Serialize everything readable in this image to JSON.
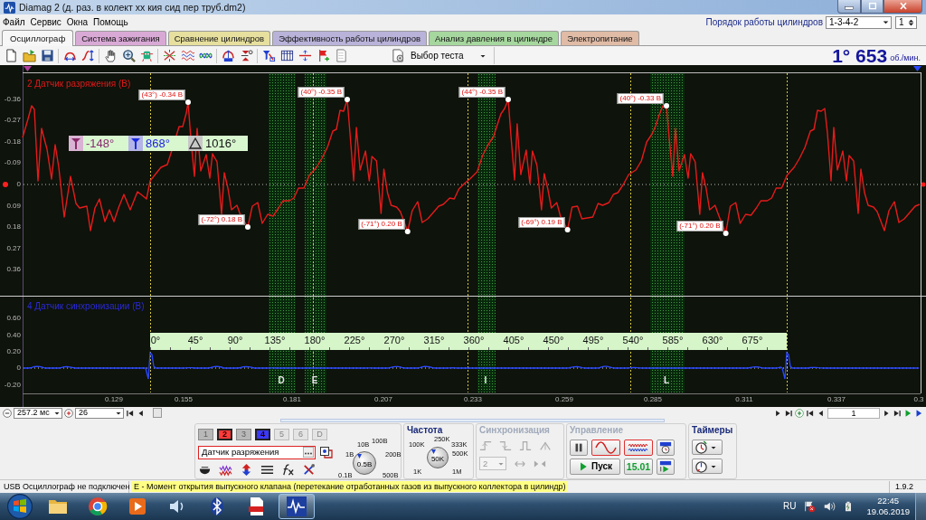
{
  "window": {
    "title": "Diamag 2 (д. раз. в колект хх кия сид пер труб.dm2)"
  },
  "menu": [
    "Файл",
    "Сервис",
    "Окна",
    "Помощь"
  ],
  "firing_order": {
    "label": "Порядок работы цилиндров",
    "value": "1-3-4-2",
    "cylinder": "1"
  },
  "tabs": [
    {
      "label": "Осциллограф",
      "selected": true,
      "color": "#f7f7f7"
    },
    {
      "label": "Система зажигания",
      "selected": false,
      "color": "#d9a9d6"
    },
    {
      "label": "Сравнение цилиндров",
      "selected": false,
      "color": "#e6df9e"
    },
    {
      "label": "Эффективность работы цилиндров",
      "selected": false,
      "color": "#b9b3d9"
    },
    {
      "label": "Анализ давления в цилиндре",
      "selected": false,
      "color": "#a6d79e"
    },
    {
      "label": "Электропитание",
      "selected": false,
      "color": "#e0bba6"
    }
  ],
  "toolbar": {
    "test_select": "Выбор теста",
    "rpm": "1° 653",
    "rpm_unit": "об./мин."
  },
  "oscillogram": {
    "upper": {
      "title": "2 Датчик разряжения (В)",
      "yticks": [
        "-0.36",
        "-0.27",
        "-0.18",
        "-0.09",
        "0",
        "0.09",
        "0.18",
        "0.27",
        "0.36"
      ],
      "peaks": [
        "(43°) -0.34 В",
        "(-72°) 0.18 В",
        "(40°) -0.35 В",
        "(-71°) 0.20 В",
        "(44°) -0.35 В",
        "(-69°) 0.19 В",
        "(40°) -0.33 В",
        "(-71°) 0.20 В"
      ],
      "cursors": {
        "first": "-148°",
        "second": "868°",
        "delta": "1016°"
      }
    },
    "lower": {
      "title": "4 Датчик синхронизации (В)",
      "yticks": [
        "0.60",
        "0.40",
        "0.20",
        "0",
        "-0.20"
      ]
    },
    "degrees": [
      "0°",
      "45°",
      "90°",
      "135°",
      "180°",
      "225°",
      "270°",
      "315°",
      "360°",
      "405°",
      "450°",
      "495°",
      "540°",
      "585°",
      "630°",
      "675°"
    ],
    "phase_marks": [
      "D",
      "E",
      "I",
      "L"
    ],
    "xticks": [
      "0.129",
      "0.155",
      "0.181",
      "0.207",
      "0.233",
      "0.259",
      "0.285",
      "0.311",
      "0.337",
      "0.3"
    ]
  },
  "navigation": {
    "timebase": "257.2 мс",
    "scale": "26",
    "page": "1"
  },
  "channels": [
    {
      "label": "1",
      "selected": false,
      "disabled": false
    },
    {
      "label": "2",
      "selected": true,
      "disabled": false,
      "color": "#ff3b3b"
    },
    {
      "label": "3",
      "selected": false,
      "disabled": false
    },
    {
      "label": "4",
      "selected": true,
      "disabled": false,
      "color": "#3a3aff"
    },
    {
      "label": "5",
      "selected": false,
      "disabled": true
    },
    {
      "label": "6",
      "selected": false,
      "disabled": true
    },
    {
      "label": "D",
      "selected": false,
      "disabled": true
    }
  ],
  "sensor": {
    "value": "Датчик разряжения"
  },
  "range": {
    "labels": [
      "10В",
      "100В",
      "1В",
      "200В",
      "0.1В",
      "500В"
    ],
    "value": "0.5В"
  },
  "frequency": {
    "title": "Частота",
    "disabled": false,
    "labels": [
      "250K",
      "100K",
      "333K",
      "500K",
      "1K",
      "1M"
    ],
    "value": "50K"
  },
  "sync": {
    "title": "Синхронизация",
    "disabled": true,
    "channel": "2"
  },
  "control": {
    "title": "Управление",
    "disabled": true,
    "start": "Пуск",
    "time": "15.01"
  },
  "timers": {
    "title": "Таймеры",
    "disabled": false
  },
  "status_bar": {
    "connection": "USB Осциллограф не подключен",
    "hint": "E - Момент открытия выпускного клапана (перетекание отработанных газов из выпускного коллектора в цилиндр)",
    "version": "1.9.2"
  },
  "taskbar": {
    "language": "RU",
    "time": "22:45",
    "date": "19.06.2019"
  }
}
